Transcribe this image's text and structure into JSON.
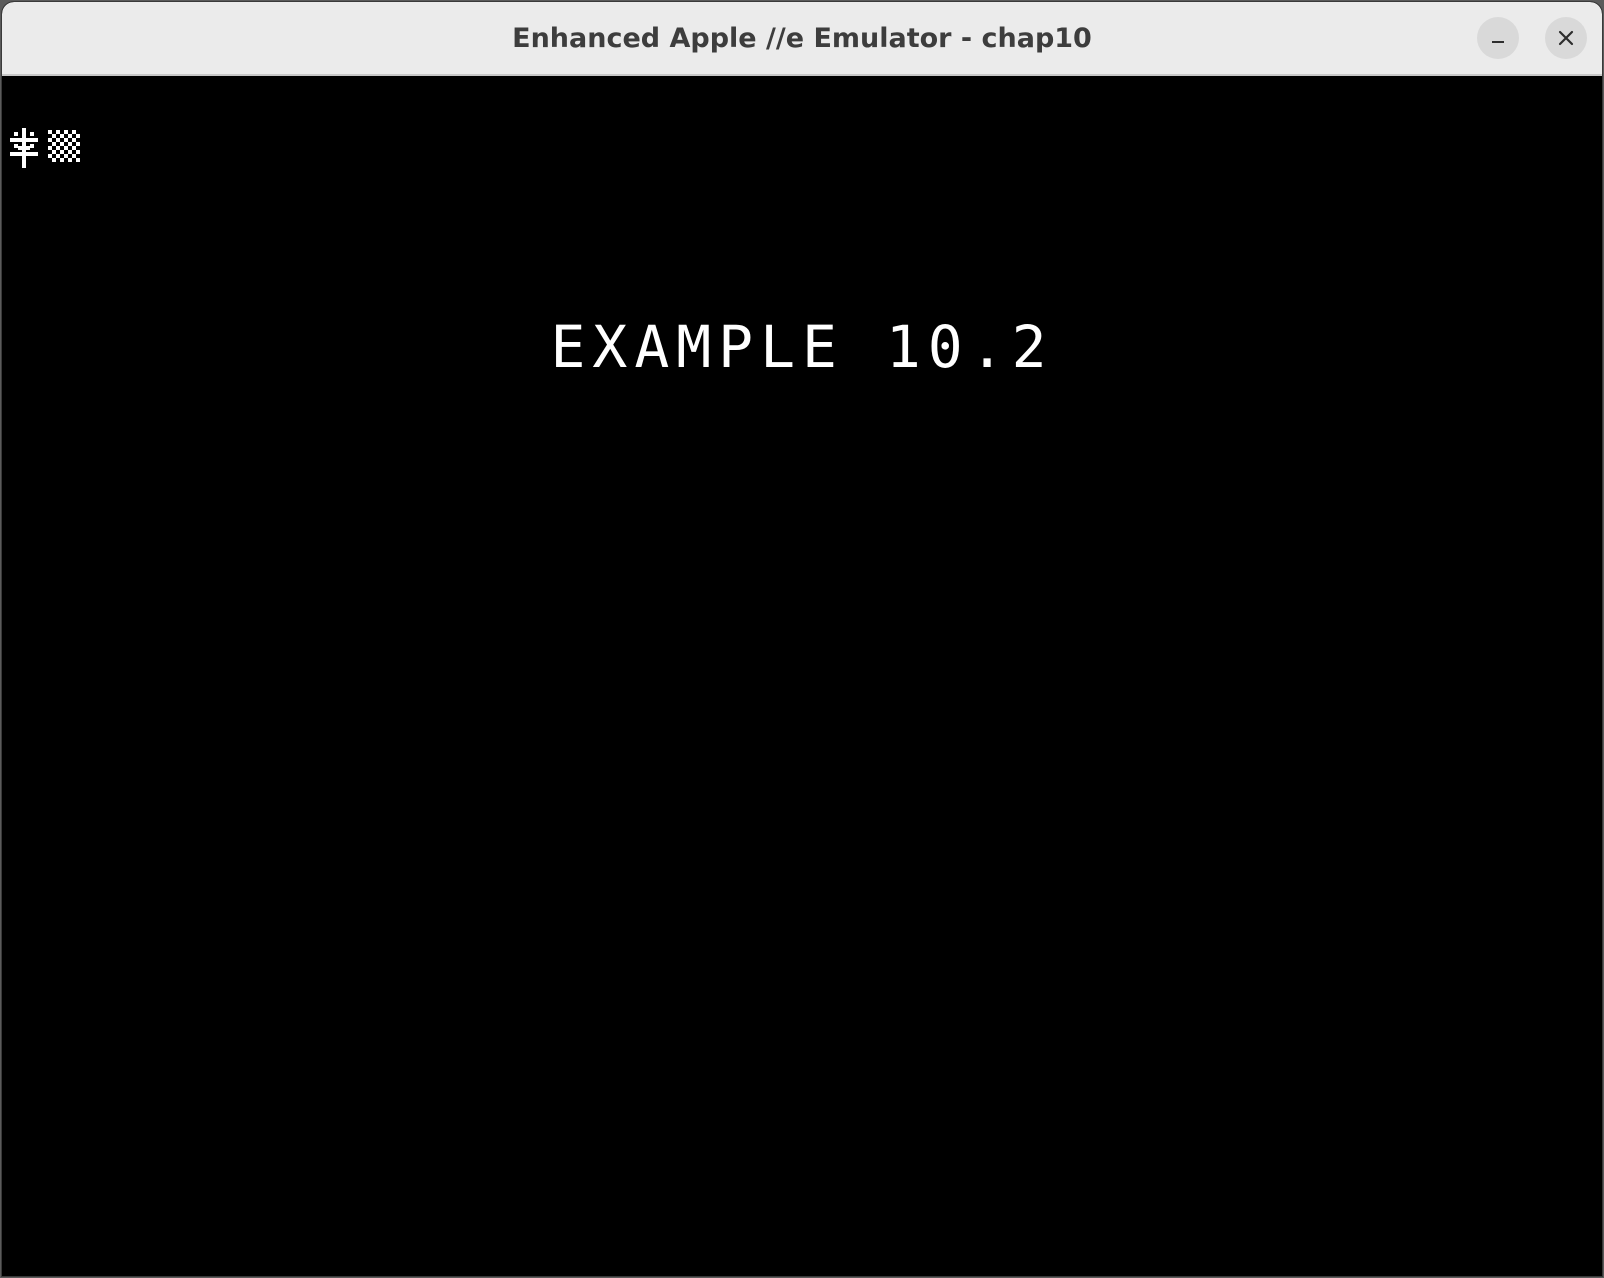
{
  "window": {
    "title": "Enhanced Apple //e Emulator - chap10"
  },
  "controls": {
    "minimize_icon": "minimize-icon",
    "close_icon": "close-icon"
  },
  "screen": {
    "prompt_glyphs": [
      "mousetext-asterisk-glyph",
      "mousetext-checkerboard-glyph"
    ],
    "text": "EXAMPLE 10.2",
    "foreground": "#ffffff",
    "background": "#000000"
  }
}
